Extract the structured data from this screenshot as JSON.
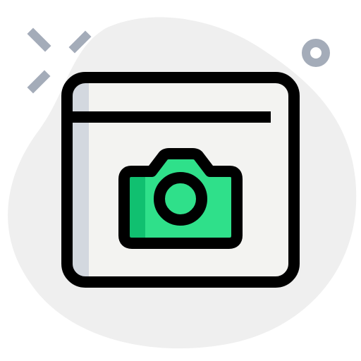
{
  "icon": {
    "name": "browser-camera-icon",
    "description_shown": "",
    "colors": {
      "blob": "#efefef",
      "outline": "#000000",
      "window_fill": "#f3f3f1",
      "window_shadow": "#d3d8df",
      "camera_fill": "#2fe08a",
      "camera_shadow": "#10c070",
      "sparkle": "#a4acb9"
    }
  }
}
